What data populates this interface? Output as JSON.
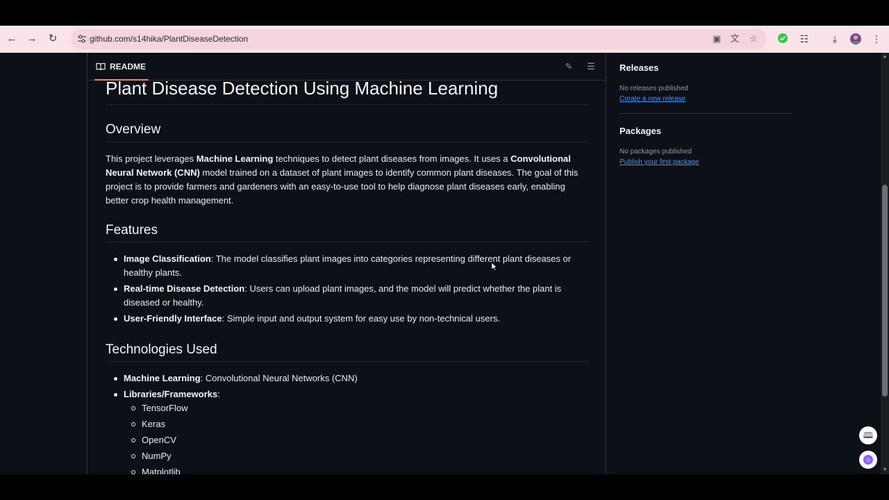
{
  "browser": {
    "url": "github.com/s14hika/PlantDiseaseDetection",
    "icons": {
      "back": "back-arrow-icon",
      "forward": "forward-arrow-icon",
      "reload": "reload-icon",
      "site_info": "tune-icon",
      "install": "install-app-icon",
      "translate": "translate-icon",
      "bookmark": "star-icon",
      "extension_check": "check-circle-icon",
      "extensions": "puzzle-icon",
      "downloads": "download-icon",
      "profile": "avatar",
      "menu": "kebab-menu-icon"
    }
  },
  "readme": {
    "tab_label": "README",
    "title": "Plant Disease Detection Using Machine Learning",
    "overview": {
      "heading": "Overview",
      "t1": "This project leverages ",
      "b1": "Machine Learning",
      "t2": " techniques to detect plant diseases from images. It uses a ",
      "b2": "Convolutional Neural Network (CNN)",
      "t3": " model trained on a dataset of plant images to identify common plant diseases. The goal of this project is to provide farmers and gardeners with an easy-to-use tool to help diagnose plant diseases early, enabling better crop health management."
    },
    "features": {
      "heading": "Features",
      "items": [
        {
          "bold": "Image Classification",
          "text": ": The model classifies plant images into categories representing different plant diseases or healthy plants."
        },
        {
          "bold": "Real-time Disease Detection",
          "text": ": Users can upload plant images, and the model will predict whether the plant is diseased or healthy."
        },
        {
          "bold": "User-Friendly Interface",
          "text": ": Simple input and output system for easy use by non-technical users."
        }
      ]
    },
    "technologies": {
      "heading": "Technologies Used",
      "items": [
        {
          "bold": "Machine Learning",
          "text": ": Convolutional Neural Networks (CNN)"
        },
        {
          "bold": "Libraries/Frameworks",
          "text": ":"
        }
      ],
      "libraries": [
        "TensorFlow",
        "Keras",
        "OpenCV",
        "NumPy",
        "Matplotlib"
      ]
    }
  },
  "sidebar": {
    "releases": {
      "heading": "Releases",
      "empty": "No releases published",
      "link": "Create a new release"
    },
    "packages": {
      "heading": "Packages",
      "empty": "No packages published",
      "link": "Publish your first package"
    }
  },
  "colors": {
    "page_bg": "#0d1117",
    "chrome_bg": "#fbe3ea",
    "link": "#4493f8",
    "tab_underline": "#f78166"
  }
}
